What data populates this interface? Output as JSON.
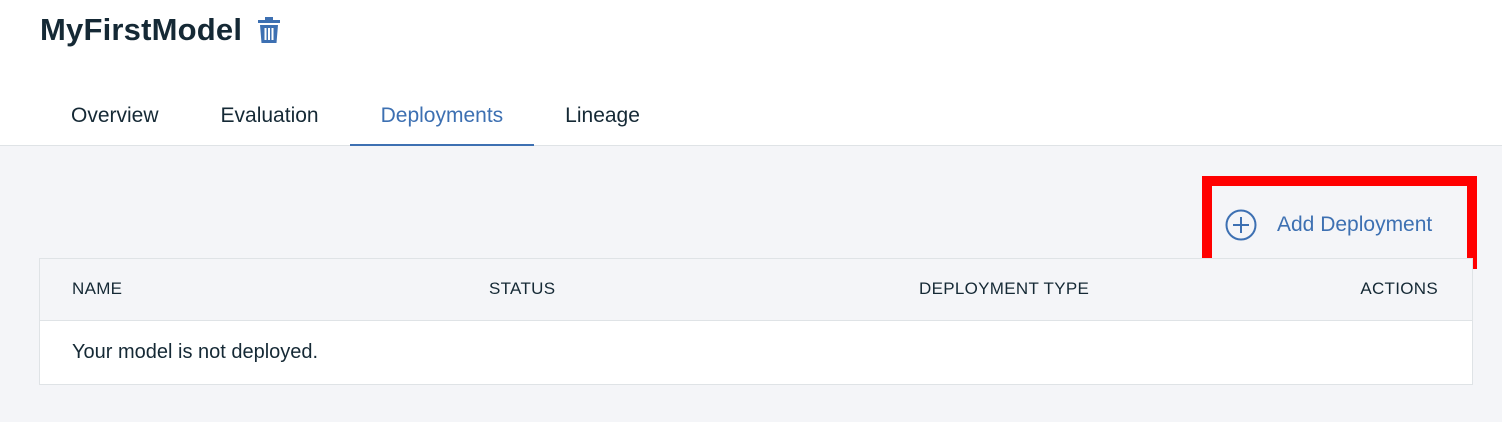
{
  "header": {
    "title": "MyFirstModel",
    "delete_icon": "trash-icon"
  },
  "tabs": [
    {
      "label": "Overview",
      "active": false
    },
    {
      "label": "Evaluation",
      "active": false
    },
    {
      "label": "Deployments",
      "active": true
    },
    {
      "label": "Lineage",
      "active": false
    }
  ],
  "toolbar": {
    "add_label": "Add Deployment",
    "add_icon": "add-circle-icon"
  },
  "table": {
    "columns": [
      "NAME",
      "STATUS",
      "DEPLOYMENT TYPE",
      "ACTIONS"
    ],
    "empty_message": "Your model is not deployed."
  },
  "colors": {
    "accent": "#3d70b2",
    "highlight": "#ff0000",
    "text": "#152935",
    "background": "#f4f5f8"
  }
}
